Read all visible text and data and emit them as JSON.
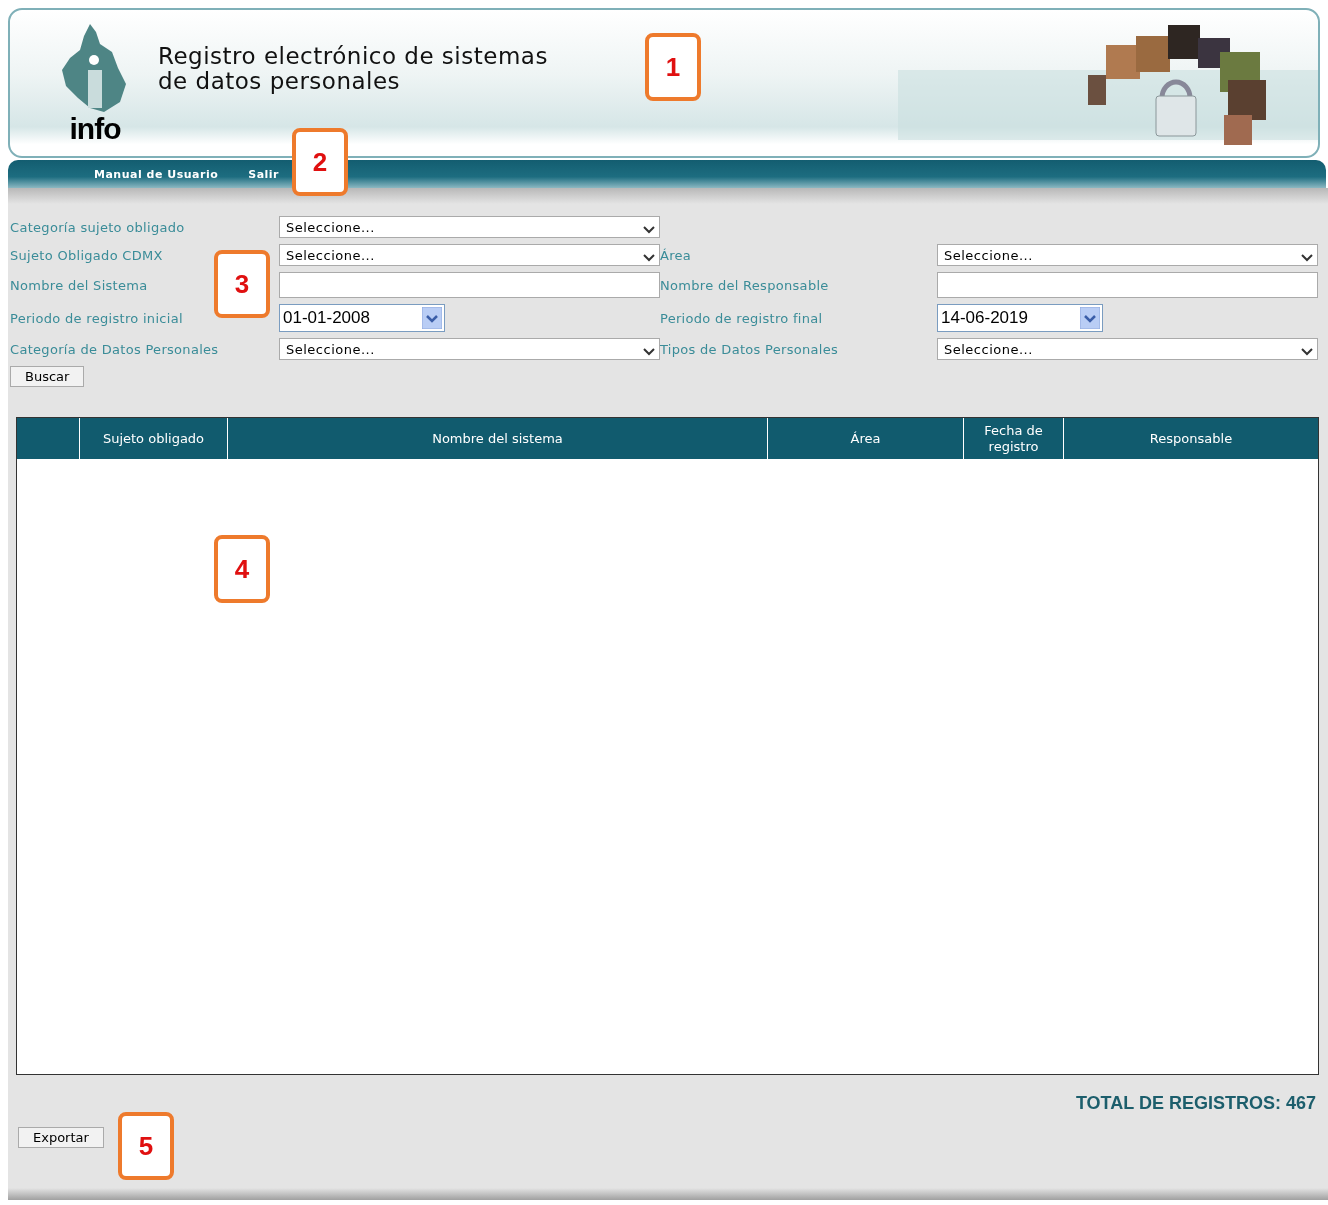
{
  "header": {
    "title_lines": [
      "Registro electrónico de sistemas",
      "de datos personales"
    ],
    "logo_text": "info"
  },
  "nav": {
    "items": [
      "Manual de Usuario",
      "Salir"
    ]
  },
  "form": {
    "rows": [
      {
        "fields": [
          {
            "label": "Categoría sujeto obligado",
            "kind": "select",
            "value": "Seleccione..."
          }
        ]
      },
      {
        "fields": [
          {
            "label": "Sujeto Obligado CDMX",
            "kind": "select",
            "value": "Seleccione..."
          },
          {
            "label": "Área",
            "kind": "select",
            "value": "Seleccione..."
          }
        ]
      },
      {
        "fields": [
          {
            "label": "Nombre del Sistema",
            "kind": "text"
          },
          {
            "label": "Nombre del Responsable",
            "kind": "text"
          }
        ]
      },
      {
        "fields": [
          {
            "label": "Periodo de registro inicial",
            "kind": "date",
            "value": "01-01-2008"
          },
          {
            "label": "Periodo de registro final",
            "kind": "date",
            "value": "14-06-2019"
          }
        ]
      },
      {
        "fields": [
          {
            "label": "Categoría de Datos Personales",
            "kind": "select",
            "value": "Seleccione..."
          },
          {
            "label": "Tipos de Datos Personales",
            "kind": "select",
            "value": "Seleccione..."
          }
        ]
      }
    ],
    "search_button": "Buscar"
  },
  "table": {
    "columns": [
      "",
      "Sujeto obligado",
      "Nombre del sistema",
      "Área",
      "Fecha de registro",
      "Responsable"
    ]
  },
  "total": "TOTAL DE REGISTROS: 467",
  "export_button": "Exportar",
  "callouts": [
    "1",
    "2",
    "3",
    "4",
    "5"
  ]
}
